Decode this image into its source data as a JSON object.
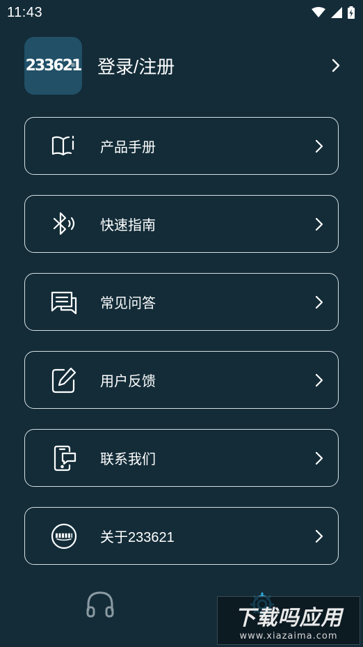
{
  "status_bar": {
    "time": "11:43",
    "icons": [
      "wifi-icon",
      "cellular-signal-icon",
      "battery-charging-icon"
    ]
  },
  "profile": {
    "logo_text": "233621",
    "logo_mark": "®",
    "label": "登录/注册",
    "chevron_icon": "chevron-right-icon"
  },
  "menu": {
    "items": [
      {
        "label": "产品手册",
        "icon": "book-icon"
      },
      {
        "label": "快速指南",
        "icon": "bluetooth-icon"
      },
      {
        "label": "常见问答",
        "icon": "chat-icon"
      },
      {
        "label": "用户反馈",
        "icon": "edit-icon"
      },
      {
        "label": "联系我们",
        "icon": "phone-message-icon"
      },
      {
        "label": "关于233621",
        "icon": "brand-logo-icon"
      }
    ]
  },
  "bottom_nav": {
    "tabs": [
      {
        "icon": "headset-icon",
        "active": false
      },
      {
        "icon": "settings-icon",
        "active": true
      }
    ]
  },
  "watermark": {
    "title": "下载吗应用",
    "url": "www.xiazaima.com"
  },
  "colors": {
    "background": "#132c38",
    "card_border": "#d7e0e4",
    "logo_bg": "#215067",
    "active_tab": "#2fa8d8",
    "inactive_tab": "#8a9aa2"
  }
}
